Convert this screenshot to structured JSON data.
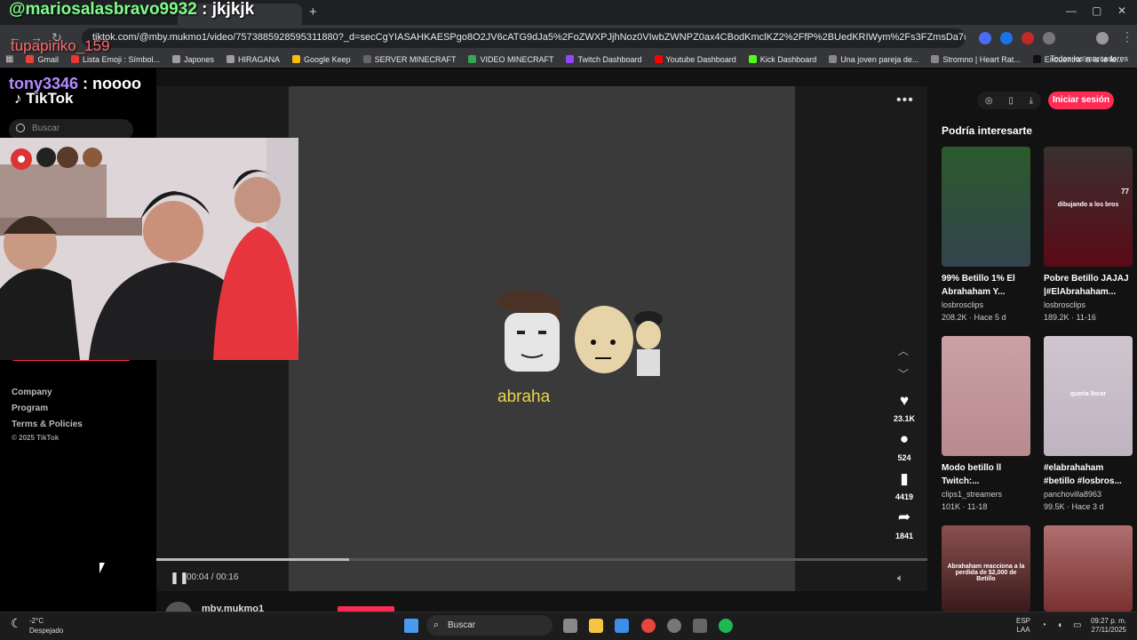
{
  "overlay": {
    "line1_user": "@mariosalasbravo9932",
    "line1_msg": " : jkjkjk",
    "line2_user": "tupapiriko_159",
    "line3_user": "tony3346",
    "line3_msg": " : noooo"
  },
  "browser": {
    "url": "tiktok.com/@mby.mukmo1/video/7573885928595311880?_d=secCgYIASAHKAESPgo8O2JV6cATG9dJa5%2FoZWXPJjhNoz0VIwbZWNPZ0ax4CBodKmclKZ2%2FfP%2BUedKRIWym%2Fs3FZmsDa7u5lZeWGgA%3D&_r=1&_svg=1...",
    "bookmarks": [
      {
        "label": "Gmail",
        "color": "#ea4335"
      },
      {
        "label": "Lista Emoji : Símbol...",
        "color": "#e53935"
      },
      {
        "label": "Japones",
        "color": "#9e9e9e"
      },
      {
        "label": "HIRAGANA",
        "color": "#9e9e9e"
      },
      {
        "label": "Google Keep",
        "color": "#fbbc04"
      },
      {
        "label": "SERVER MINECRAFT",
        "color": "#666"
      },
      {
        "label": "VIDEO MINECRAFT",
        "color": "#34a853"
      },
      {
        "label": "Twitch Dashboard",
        "color": "#9146ff"
      },
      {
        "label": "Youtube Dashboard",
        "color": "#ff0000"
      },
      {
        "label": "Kick Dashboard",
        "color": "#53fc18"
      },
      {
        "label": "Una joven pareja de...",
        "color": "#888"
      },
      {
        "label": "Stromno | Heart Rat...",
        "color": "#888"
      },
      {
        "label": "Encuentra 'ia ia ie ie...",
        "color": "#111"
      }
    ],
    "all_bookmarks": "Todos los marcadores"
  },
  "tiktok": {
    "logo": "TikTok",
    "search_placeholder": "Buscar",
    "footer": [
      "Company",
      "Program",
      "Terms & Policies"
    ],
    "copyright": "© 2025 TikTok",
    "login": "Iniciar sesión",
    "interest_title": "Podría interesarte"
  },
  "video": {
    "caption": "abraha",
    "time": "00:04 / 00:16",
    "progress": 0.25,
    "likes": "23.1K",
    "comments": "524",
    "saves": "4419",
    "shares": "1841",
    "author": "mby.mukmo1"
  },
  "suggestions": [
    {
      "title": "99% Betillo 1% El Abrahaham Y...",
      "author": "losbrosclips",
      "stats": "208.2K · Hace 5 d",
      "colors": [
        "#2c5a2c",
        "#34434d"
      ]
    },
    {
      "title": "Pobre Betillo JAJAJ |#ElAbrahaham...",
      "author": "losbrosclips",
      "stats": "189.2K · 11-16",
      "colors": [
        "#3a3030",
        "#5a0a16"
      ],
      "badge": "77",
      "inner": "dibujando a los bros"
    },
    {
      "title": "Modo betillo ll Twitch:...",
      "author": "clips1_streamers",
      "stats": "101K · 11-18",
      "colors": [
        "#caa1a4",
        "#b88a8e"
      ]
    },
    {
      "title": "#elabrahaham #betillo #losbros...",
      "author": "panchovilla8963",
      "stats": "99.5K · Hace 3 d",
      "colors": [
        "#cfc6cf",
        "#bfb3bf"
      ],
      "inner": "quería llorar"
    },
    {
      "title": "",
      "author": "",
      "stats": "",
      "colors": [
        "#8a5050",
        "#3a1a1a"
      ],
      "inner": "Abrahaham reacciona a la perdida de $2,000 de Betillo"
    },
    {
      "title": "",
      "author": "",
      "stats": "",
      "colors": [
        "#b07070",
        "#7a3030"
      ]
    }
  ],
  "taskbar": {
    "temp": "-2°C",
    "weather": "Despejado",
    "search": "Buscar",
    "lang1": "ESP",
    "lang2": "LAA",
    "time": "09:27 p. m.",
    "date": "27/11/2025"
  }
}
